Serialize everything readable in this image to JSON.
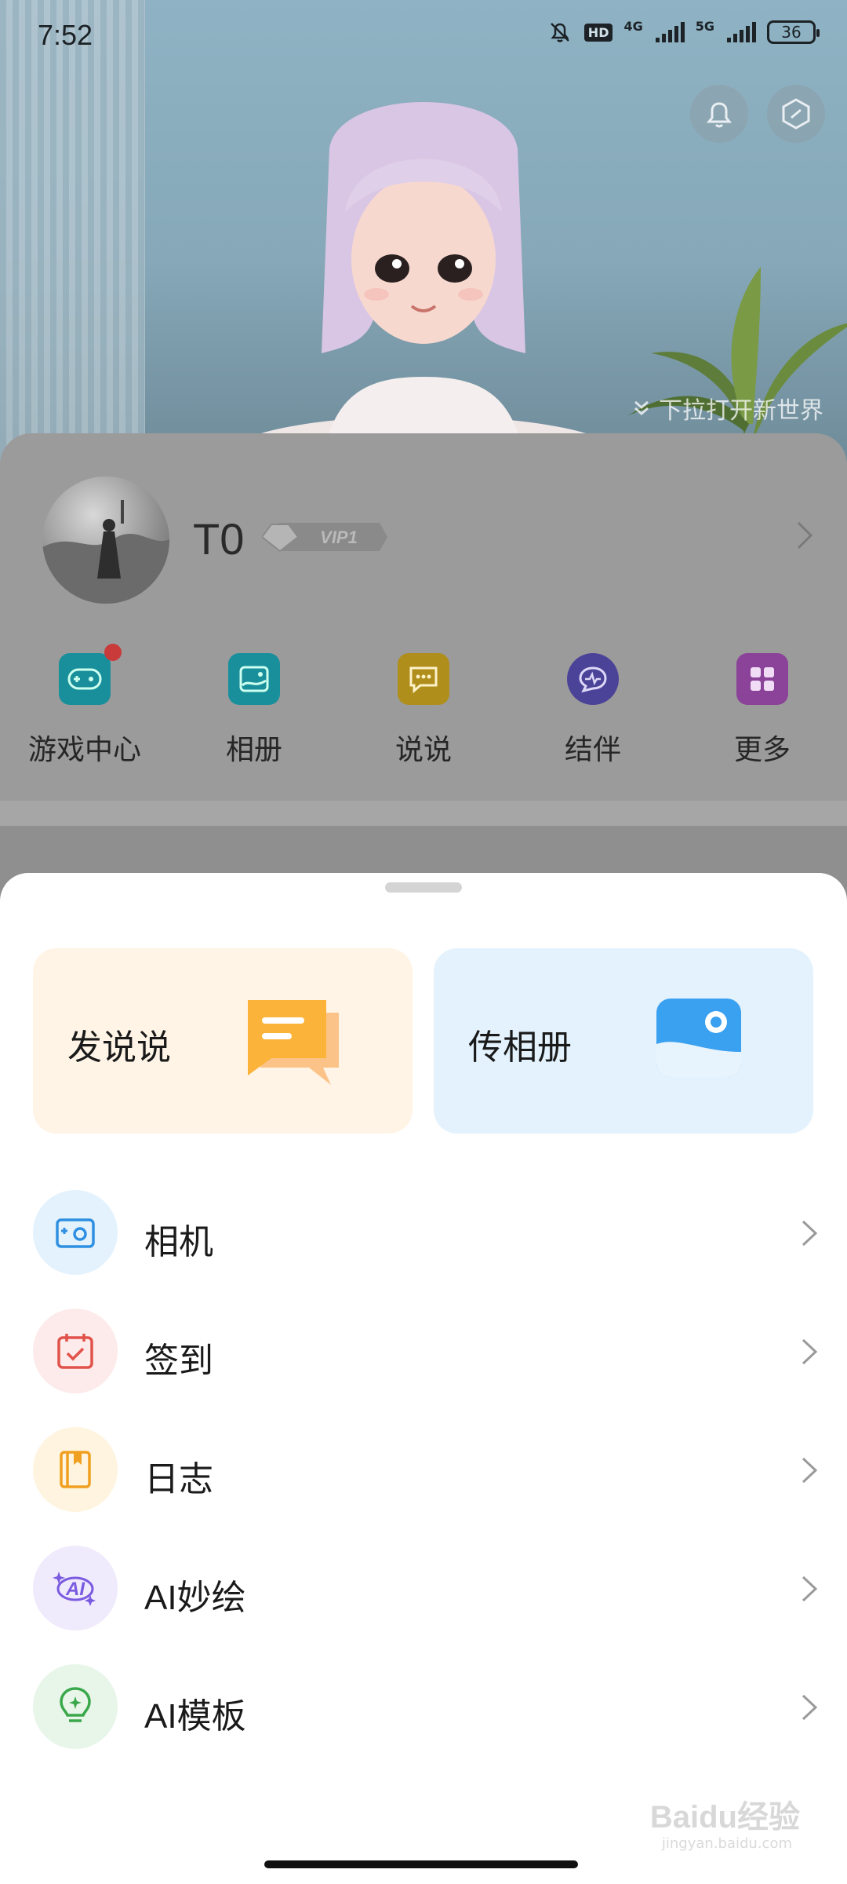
{
  "status_bar": {
    "time": "7:52",
    "hd_label": "HD",
    "net1": "4G",
    "net2": "5G",
    "battery": "36"
  },
  "hero": {
    "pull_hint": "下拉打开新世界"
  },
  "profile": {
    "username": "T0",
    "vip_label": "VIP1"
  },
  "quick_actions": [
    {
      "label": "游戏中心",
      "color": "#1aa3b3",
      "icon": "gamepad-icon",
      "badge": true
    },
    {
      "label": "相册",
      "color": "#1aa0b0",
      "icon": "photo-icon",
      "badge": false
    },
    {
      "label": "说说",
      "color": "#c9a21f",
      "icon": "chat-bubble-icon",
      "badge": false
    },
    {
      "label": "结伴",
      "color": "#5a4fb0",
      "icon": "pulse-chat-icon",
      "badge": false
    },
    {
      "label": "更多",
      "color": "#9a4fb0",
      "icon": "grid-icon",
      "badge": false
    }
  ],
  "sheet": {
    "cards": [
      {
        "label": "发说说",
        "icon": "post-chat-icon",
        "bg": "#fff4e6"
      },
      {
        "label": "传相册",
        "icon": "upload-album-icon",
        "bg": "#e3f2fd"
      }
    ],
    "menu": [
      {
        "label": "相机",
        "icon": "camera-icon",
        "bg": "#e3f2fd",
        "color": "#2f8fe0"
      },
      {
        "label": "签到",
        "icon": "calendar-check-icon",
        "bg": "#fdeaea",
        "color": "#e0524a"
      },
      {
        "label": "日志",
        "icon": "journal-icon",
        "bg": "#fff4e0",
        "color": "#f0a020"
      },
      {
        "label": "AI妙绘",
        "icon": "ai-paint-icon",
        "bg": "#efeafc",
        "color": "#7a5ae0"
      },
      {
        "label": "AI模板",
        "icon": "lightbulb-icon",
        "bg": "#e8f6ea",
        "color": "#3aa84a"
      }
    ]
  },
  "watermark": {
    "main": "Baidu经验",
    "sub": "jingyan.baidu.com"
  }
}
